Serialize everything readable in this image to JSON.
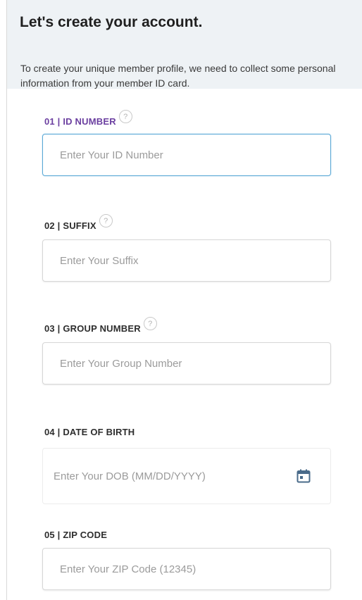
{
  "header": {
    "title": "Let's create your account.",
    "intro": "To create your unique member profile, we need to collect some personal information from your member ID card."
  },
  "fields": [
    {
      "label": "01 | ID NUMBER",
      "placeholder": "Enter Your ID Number",
      "help_icon": "help-circle-icon",
      "state": "focused"
    },
    {
      "label": "02 | SUFFIX",
      "placeholder": "Enter Your Suffix",
      "help_icon": "help-circle-icon"
    },
    {
      "label": "03 | GROUP NUMBER",
      "placeholder": "Enter Your Group Number",
      "help_icon": "help-circle-icon"
    },
    {
      "label": "04 | DATE OF BIRTH",
      "placeholder": "Enter Your DOB (MM/DD/YYYY)",
      "trailing_icon": "calendar-icon"
    },
    {
      "label": "05 | ZIP CODE",
      "placeholder": "Enter Your ZIP Code (12345)"
    }
  ],
  "colors": {
    "header_bg": "#eef2f5",
    "active_label": "#6b3fa0",
    "focus_border": "#5aa8d6",
    "calendar_icon": "#4a6b8a"
  }
}
